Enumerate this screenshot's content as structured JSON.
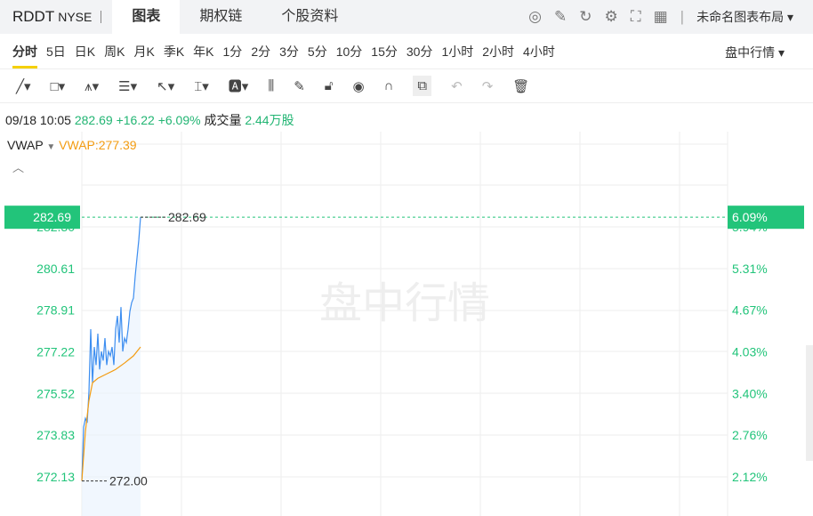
{
  "header": {
    "symbol": "RDDT",
    "exchange": "NYSE",
    "tabs": [
      "图表",
      "期权链",
      "个股资料"
    ],
    "layout": "未命名图表布局 ▾"
  },
  "periods": [
    "分时",
    "5日",
    "日K",
    "周K",
    "月K",
    "季K",
    "年K",
    "1分",
    "2分",
    "3分",
    "5分",
    "10分",
    "15分",
    "30分",
    "1小时",
    "2小时",
    "4小时"
  ],
  "mode": "盘中行情 ▾",
  "tools": [
    "line-tool-icon",
    "rectangle-tool-icon",
    "pattern-tool-icon",
    "fib-tool-icon",
    "arrow-tool-icon",
    "measure-tool-icon",
    "text-tool-icon",
    "candle-tool-icon",
    "pencil-icon",
    "lock-icon",
    "eye-icon",
    "magnet-icon",
    "layers-icon",
    "undo-icon",
    "redo-icon",
    "trash-icon"
  ],
  "quote": {
    "datetime": "09/18 10:05",
    "price": "282.69",
    "change": "+16.22",
    "pct": "+6.09%",
    "vol_label": "成交量",
    "volume": "2.44万股"
  },
  "indicator": {
    "name": "VWAP",
    "value": "VWAP:277.39"
  },
  "watermark": "盘中行情",
  "colors": {
    "up": "#22c47a",
    "price_line": "#3d8ef0",
    "vwap": "#f39c12"
  },
  "chart_data": {
    "type": "line",
    "y_ticks": [
      "282.30",
      "280.61",
      "278.91",
      "277.22",
      "275.52",
      "273.83",
      "272.13"
    ],
    "pct_ticks": [
      "5.94%",
      "5.31%",
      "4.67%",
      "4.03%",
      "3.40%",
      "2.76%",
      "2.12%"
    ],
    "current_label": "282.69",
    "current_pct": "6.09%",
    "high_label": "282.69",
    "low_label": "272.00",
    "ylim": [
      271.7,
      284.3
    ],
    "price": [
      272.01,
      274.18,
      274.54,
      274.36,
      275.62,
      278.15,
      275.98,
      277.43,
      276.7,
      277.97,
      276.52,
      277.25,
      276.88,
      277.79,
      276.7,
      277.25,
      277.07,
      277.43,
      276.7,
      278.15,
      278.69,
      277.61,
      279.05,
      277.25,
      277.79,
      277.61,
      278.15,
      278.87,
      279.23,
      279.41,
      280.31,
      281.04,
      281.76,
      282.69
    ],
    "vwap": [
      272.01,
      null,
      274.0,
      null,
      275.26,
      null,
      275.98,
      null,
      null,
      276.16,
      null,
      null,
      null,
      null,
      276.34,
      null,
      null,
      null,
      null,
      276.52,
      null,
      null,
      null,
      null,
      276.78,
      null,
      null,
      null,
      null,
      277.07,
      null,
      null,
      null,
      277.43
    ]
  }
}
